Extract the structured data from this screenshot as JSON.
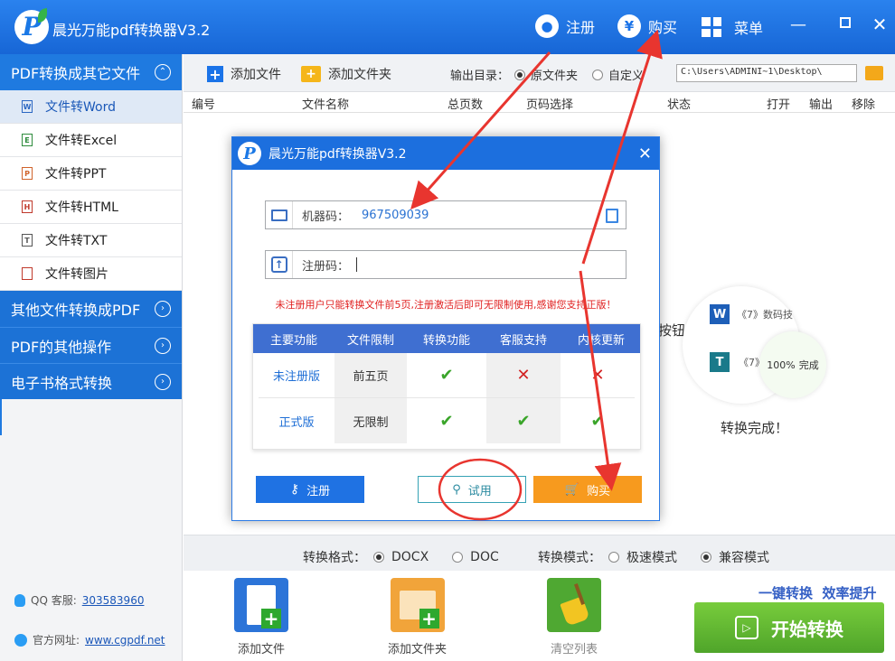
{
  "app": {
    "title": "晨光万能pdf转换器V3.2",
    "register_label": "注册",
    "buy_label": "购买",
    "menu_label": "菜单",
    "buy_glyph": "¥"
  },
  "sidebar": {
    "section_active": "PDF转换成其它文件",
    "items": [
      {
        "label": "文件转Word",
        "badge": "W"
      },
      {
        "label": "文件转Excel",
        "badge": "E"
      },
      {
        "label": "文件转PPT",
        "badge": "P"
      },
      {
        "label": "文件转HTML",
        "badge": "H"
      },
      {
        "label": "文件转TXT",
        "badge": "T"
      },
      {
        "label": "文件转图片",
        "badge": ""
      }
    ],
    "sections": [
      "其他文件转换成PDF",
      "PDF的其他操作",
      "电子书格式转换"
    ],
    "qq_label": "QQ 客服:",
    "qq_value": "303583960",
    "site_label": "官方网址:",
    "site_value": "www.cgpdf.net"
  },
  "toolbar": {
    "add_file": "添加文件",
    "add_folder": "添加文件夹",
    "output_label": "输出目录：",
    "radio_original": "原文件夹",
    "radio_custom": "自定义",
    "path_value": "C:\\Users\\ADMINI~1\\Desktop\\"
  },
  "table_headers": [
    "编号",
    "文件名称",
    "总页数",
    "页码选择",
    "状态",
    "打开",
    "输出",
    "移除"
  ],
  "background": {
    "hint_partial": "按钮",
    "doc1": "《7》数码技",
    "doc2": "《7》",
    "progress": "100%",
    "progress_status": "完成",
    "done_text": "转换完成！"
  },
  "dialog": {
    "title": "晨光万能pdf转换器V3.2",
    "machine_label": "机器码：",
    "machine_value": "967509039",
    "reg_label": "注册码：",
    "reg_value": "",
    "warning": "未注册用户只能转换文件前5页,注册激活后即可无限制使用,感谢您支持正版！",
    "compare": {
      "headers": [
        "主要功能",
        "文件限制",
        "转换功能",
        "客服支持",
        "内核更新"
      ],
      "rows": [
        {
          "version": "未注册版",
          "limit": "前五页",
          "convert": "✔",
          "support": "✕",
          "update": "✕"
        },
        {
          "version": "正式版",
          "limit": "无限制",
          "convert": "✔",
          "support": "✔",
          "update": "✔"
        }
      ]
    },
    "btn_register": "注册",
    "btn_trial": "试用",
    "btn_buy": "购买",
    "colors": {
      "register": "#1f72e3",
      "trial_border": "#35a2b5",
      "buy": "#f79a1e"
    }
  },
  "options": {
    "format_label": "转换格式：",
    "format_docx": "DOCX",
    "format_doc": "DOC",
    "mode_label": "转换模式：",
    "mode_fast": "极速模式",
    "mode_compat": "兼容模式"
  },
  "bottom": {
    "add_file": "添加文件",
    "add_folder": "添加文件夹",
    "clear_list": "清空列表",
    "slogan": "一键转换  效率提升",
    "start": "开始转换"
  }
}
